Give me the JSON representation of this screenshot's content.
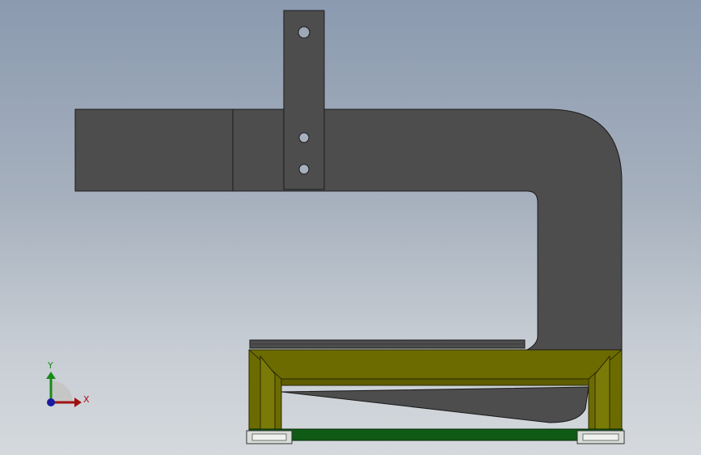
{
  "viewport": {
    "background_top": "#8b9ab0",
    "background_bottom": "#d5d9dd"
  },
  "model": {
    "part_color": "#4e4d4d",
    "edge_color": "#1a1a1a",
    "frame_color": "#6b6b00",
    "frame_edge_color": "#2a2a00",
    "base_bar_color": "#0f5a14",
    "foot_color": "#d8ddd8"
  },
  "triad": {
    "x_label": "X",
    "y_label": "Y",
    "x_color": "#a01010",
    "y_color": "#1a8a1a",
    "z_color": "#1a1aa0"
  }
}
